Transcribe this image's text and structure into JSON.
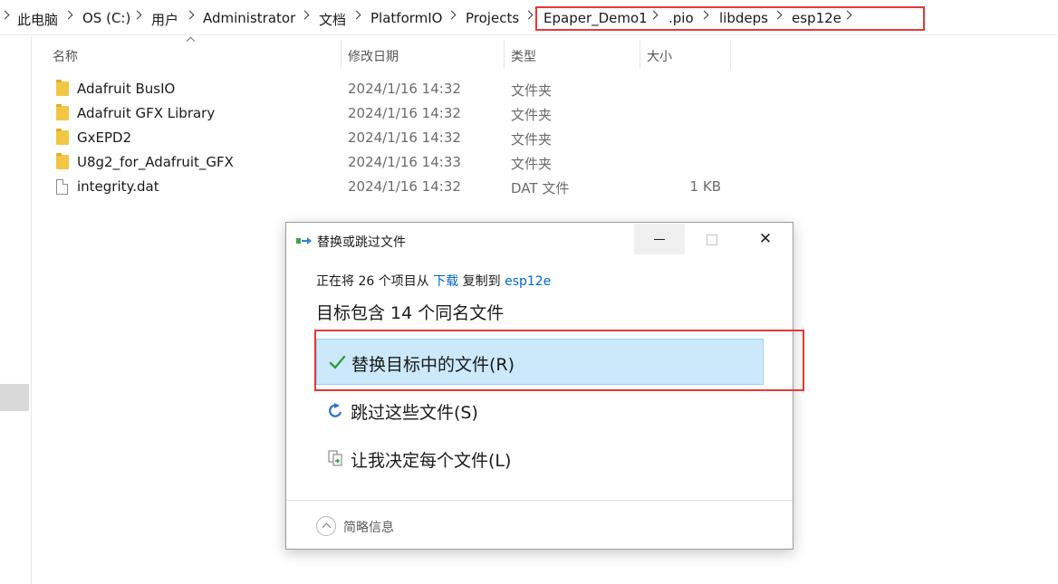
{
  "breadcrumb": {
    "items": [
      "此电脑",
      "OS (C:)",
      "用户",
      "Administrator",
      "文档",
      "PlatformIO",
      "Projects",
      "Epaper_Demo1",
      ".pio",
      "libdeps",
      "esp12e"
    ],
    "highlight_color": "#e53935"
  },
  "columns": {
    "name": "名称",
    "modified": "修改日期",
    "type": "类型",
    "size": "大小"
  },
  "files": [
    {
      "icon": "folder-icon",
      "name": "Adafruit BusIO",
      "modified": "2024/1/16 14:32",
      "type": "文件夹",
      "size": ""
    },
    {
      "icon": "folder-icon",
      "name": "Adafruit GFX Library",
      "modified": "2024/1/16 14:32",
      "type": "文件夹",
      "size": ""
    },
    {
      "icon": "folder-icon",
      "name": "GxEPD2",
      "modified": "2024/1/16 14:32",
      "type": "文件夹",
      "size": ""
    },
    {
      "icon": "folder-icon",
      "name": "U8g2_for_Adafruit_GFX",
      "modified": "2024/1/16 14:33",
      "type": "文件夹",
      "size": ""
    },
    {
      "icon": "file-icon",
      "name": "integrity.dat",
      "modified": "2024/1/16 14:32",
      "type": "DAT 文件",
      "size": "1 KB"
    }
  ],
  "dialog": {
    "title": "替换或跳过文件",
    "copy_prefix": "正在将 26 个项目从 ",
    "copy_source": "下载",
    "copy_middle": " 复制到 ",
    "copy_target": "esp12e",
    "heading": "目标包含 14 个同名文件",
    "options": {
      "replace": "替换目标中的文件(R)",
      "skip": "跳过这些文件(S)",
      "decide": "让我决定每个文件(L)"
    },
    "details": "简略信息",
    "close_symbol": "✕",
    "selected_color": "#cce8fb"
  }
}
